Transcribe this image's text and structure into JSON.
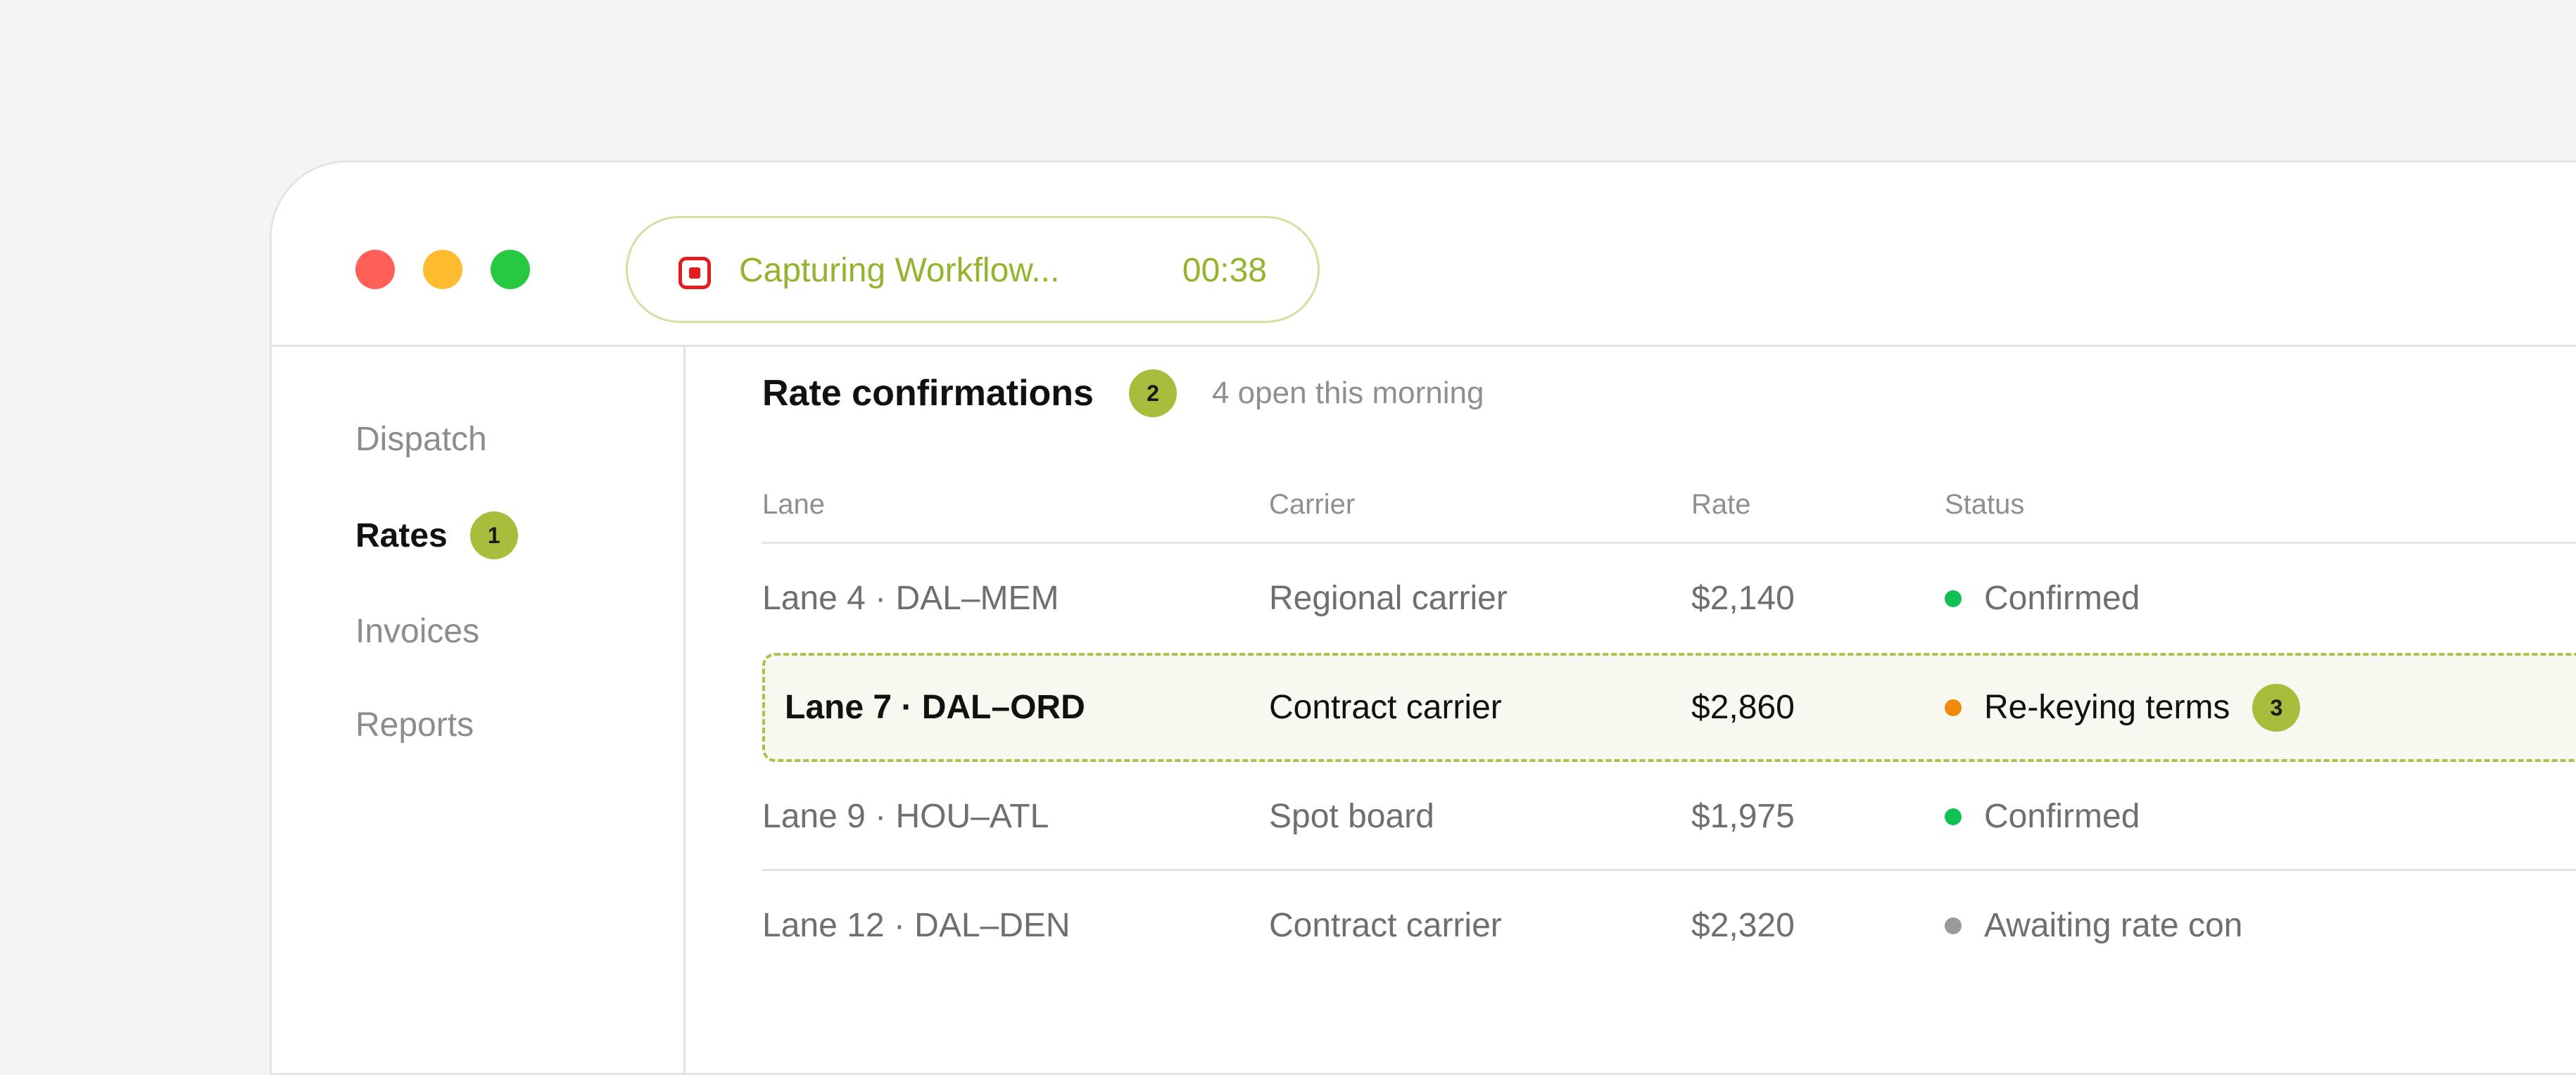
{
  "window": {
    "recording": {
      "label": "Capturing Workflow...",
      "timer": "00:38",
      "icon": "record-stop-icon",
      "accent_color": "#93b42c",
      "icon_color": "#e11d1d"
    }
  },
  "sidebar": {
    "items": [
      {
        "label": "Dispatch",
        "active": false
      },
      {
        "label": "Rates",
        "active": true,
        "badge": "1"
      },
      {
        "label": "Invoices",
        "active": false
      },
      {
        "label": "Reports",
        "active": false
      }
    ]
  },
  "main": {
    "title": "Rate confirmations",
    "badge": "2",
    "subtitle": "4 open this morning",
    "table": {
      "columns": [
        "Lane",
        "Carrier",
        "Rate",
        "Status"
      ],
      "rows": [
        {
          "lane": "Lane 4 · DAL–MEM",
          "carrier": "Regional carrier",
          "rate": "$2,140",
          "status": "Confirmed",
          "status_color": "#12c153"
        },
        {
          "lane": "Lane 7 · DAL–ORD",
          "carrier": "Contract carrier",
          "rate": "$2,860",
          "status": "Re-keying terms",
          "status_color": "#ef8a0f",
          "badge": "3",
          "selected": true
        },
        {
          "lane": "Lane 9 · HOU–ATL",
          "carrier": "Spot board",
          "rate": "$1,975",
          "status": "Confirmed",
          "status_color": "#12c153"
        },
        {
          "lane": "Lane 12 · DAL–DEN",
          "carrier": "Contract carrier",
          "rate": "$2,320",
          "status": "Awaiting rate con",
          "status_color": "#9a9a9a"
        }
      ]
    }
  },
  "colors": {
    "badge": "#a8bd3c",
    "selected_row_bg": "#f7f8ef",
    "selected_row_border": "#a8c24a"
  }
}
